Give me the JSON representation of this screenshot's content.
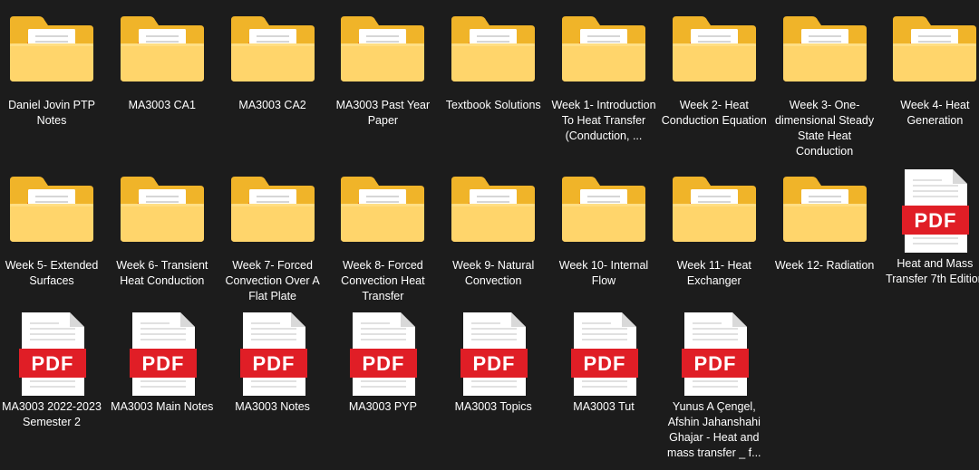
{
  "explorer": {
    "items": [
      {
        "name": "Daniel Jovin PTP Notes",
        "type": "folder",
        "icon": "folder-icon"
      },
      {
        "name": "MA3003 CA1",
        "type": "folder",
        "icon": "folder-icon"
      },
      {
        "name": "MA3003 CA2",
        "type": "folder",
        "icon": "folder-icon"
      },
      {
        "name": "MA3003 Past Year Paper",
        "type": "folder",
        "icon": "folder-icon"
      },
      {
        "name": "Textbook Solutions",
        "type": "folder",
        "icon": "folder-icon"
      },
      {
        "name": "Week 1- Introduction To Heat Transfer (Conduction, ...",
        "type": "folder",
        "icon": "folder-icon"
      },
      {
        "name": "Week 2- Heat Conduction Equation",
        "type": "folder",
        "icon": "folder-icon"
      },
      {
        "name": "Week 3- One-dimensional Steady State Heat Conduction",
        "type": "folder",
        "icon": "folder-icon"
      },
      {
        "name": "Week 4- Heat Generation",
        "type": "folder",
        "icon": "folder-icon"
      },
      {
        "name": "Week 5- Extended Surfaces",
        "type": "folder",
        "icon": "folder-icon"
      },
      {
        "name": "Week 6- Transient Heat Conduction",
        "type": "folder",
        "icon": "folder-icon"
      },
      {
        "name": "Week 7- Forced Convection Over A Flat Plate",
        "type": "folder",
        "icon": "folder-icon"
      },
      {
        "name": "Week 8- Forced Convection Heat Transfer",
        "type": "folder",
        "icon": "folder-icon"
      },
      {
        "name": "Week 9- Natural Convection",
        "type": "folder",
        "icon": "folder-icon"
      },
      {
        "name": "Week 10- Internal Flow",
        "type": "folder",
        "icon": "folder-icon"
      },
      {
        "name": "Week 11- Heat Exchanger",
        "type": "folder",
        "icon": "folder-icon"
      },
      {
        "name": "Week 12- Radiation",
        "type": "folder",
        "icon": "folder-icon"
      },
      {
        "name": "Heat and Mass Transfer 7th Edition",
        "type": "pdf",
        "icon": "pdf-file-icon"
      },
      {
        "name": "MA3003 2022-2023 Semester 2",
        "type": "pdf",
        "icon": "pdf-file-icon"
      },
      {
        "name": "MA3003 Main Notes",
        "type": "pdf",
        "icon": "pdf-file-icon"
      },
      {
        "name": "MA3003 Notes",
        "type": "pdf",
        "icon": "pdf-file-icon"
      },
      {
        "name": "MA3003 PYP",
        "type": "pdf",
        "icon": "pdf-file-icon"
      },
      {
        "name": "MA3003 Topics",
        "type": "pdf",
        "icon": "pdf-file-icon"
      },
      {
        "name": "MA3003 Tut",
        "type": "pdf",
        "icon": "pdf-file-icon"
      },
      {
        "name": "Yunus A Çengel, Afshin Jahanshahi Ghajar - Heat and mass transfer _ f...",
        "type": "pdf",
        "icon": "pdf-file-icon"
      }
    ],
    "pdf_badge_text": "PDF",
    "colors": {
      "background": "#1c1c1c",
      "folder_back": "#f0b429",
      "folder_front": "#ffd56b",
      "pdf_red": "#e01e26",
      "paper": "#ffffff"
    }
  }
}
